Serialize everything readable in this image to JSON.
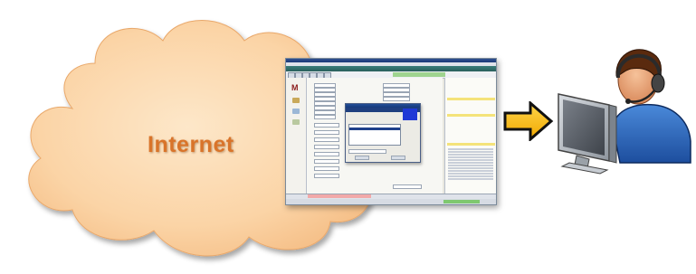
{
  "cloud": {
    "label": "Internet",
    "fill_color": "#fbd4a6",
    "label_color": "#d9742a"
  },
  "app_screenshot": {
    "description_icon": "application-window",
    "logo_letter": "M",
    "accent_colors": {
      "header": "#2a5f5c",
      "dialog_highlight": "#1f38d6",
      "status_ok": "#7fc86f",
      "alert": "#f2a9a9"
    }
  },
  "arrow": {
    "icon": "arrow-right-icon",
    "fill_color": "#f5b400"
  },
  "agent": {
    "icon": "call-center-agent-icon"
  }
}
